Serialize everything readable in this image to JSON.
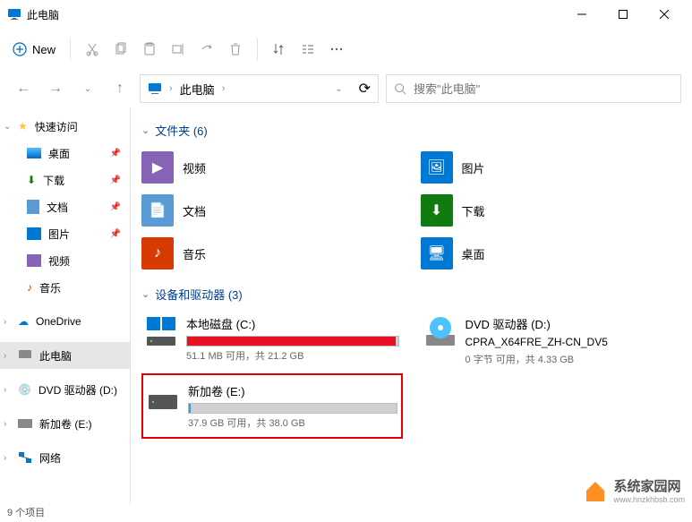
{
  "window": {
    "title": "此电脑",
    "new_btn": "New"
  },
  "address": {
    "root": "此电脑",
    "sep": "›"
  },
  "search": {
    "placeholder": "搜索\"此电脑\""
  },
  "sidebar": {
    "quick": "快速访问",
    "desktop": "桌面",
    "downloads": "下载",
    "documents": "文档",
    "pictures": "图片",
    "videos": "视频",
    "music": "音乐",
    "onedrive": "OneDrive",
    "thispc": "此电脑",
    "dvd": "DVD 驱动器 (D:)",
    "newvol": "新加卷 (E:)",
    "network": "网络"
  },
  "sections": {
    "folders": "文件夹 (6)",
    "drives": "设备和驱动器 (3)"
  },
  "folders": {
    "videos": "视频",
    "pictures": "图片",
    "documents": "文档",
    "downloads": "下载",
    "music": "音乐",
    "desktop": "桌面"
  },
  "drives": {
    "c": {
      "name": "本地磁盘 (C:)",
      "status": "51.1 MB 可用，共 21.2 GB",
      "fill_color": "#e81123",
      "fill_pct": "99%"
    },
    "d": {
      "name": "DVD 驱动器 (D:)",
      "sub": "CPRA_X64FRE_ZH-CN_DV5",
      "status": "0 字节 可用，共 4.33 GB"
    },
    "e": {
      "name": "新加卷 (E:)",
      "status": "37.9 GB 可用，共 38.0 GB",
      "fill_color": "#26a0da",
      "fill_pct": "1%"
    }
  },
  "status": {
    "count": "9 个项目"
  },
  "watermark": {
    "text": "系统家园网",
    "url": "www.hnzkhbsb.com"
  }
}
